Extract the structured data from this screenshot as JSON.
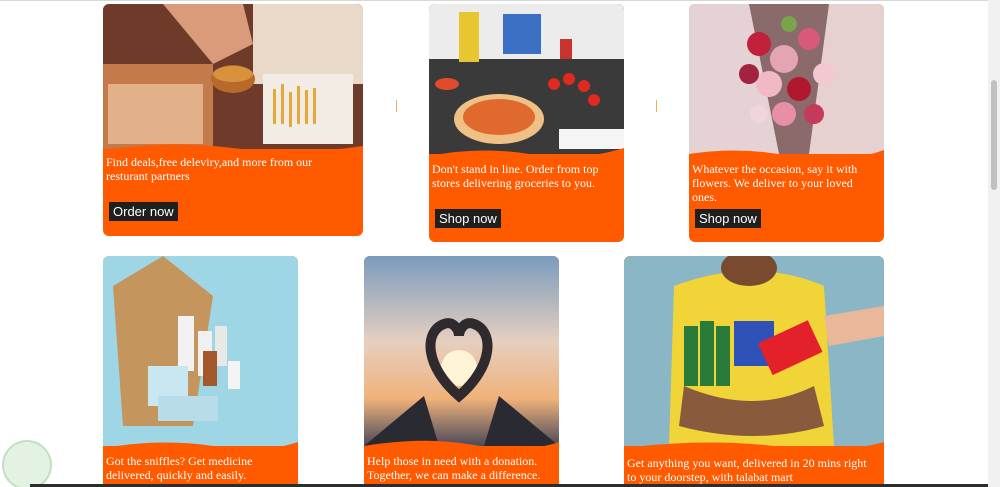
{
  "cards": [
    {
      "description": "Find deals,free deleviry,and more from our resturant partners",
      "button": "Order now"
    },
    {
      "description": "Don't stand in line. Order from top stores delivering groceries to you.",
      "button": "Shop now"
    },
    {
      "description": "Whatever the occasion, say it with flowers. We deliver to your loved ones.",
      "button": "Shop now"
    },
    {
      "description": "Got the sniffles? Get medicine delivered, quickly and easily."
    },
    {
      "description": "Help those in need with a donation. Together, we can make a difference."
    },
    {
      "description": "Get anything you want, delivered in 20 mins right to your doorstep, with talabat mart"
    }
  ],
  "colors": {
    "accent": "#ff5a00",
    "button_bg": "#1f1f1f"
  }
}
